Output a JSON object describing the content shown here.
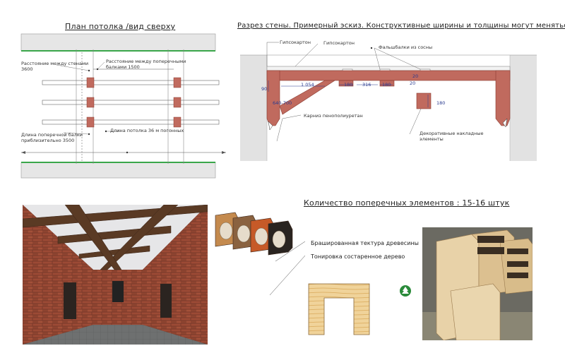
{
  "plan": {
    "title": "План потолка /вид сверху",
    "label_wall_distance": "Расстояние между стенами\n3600",
    "label_beam_distance": "Расстояние между поперечными\nбалками 1500",
    "label_beam_length": "Длина поперечной балки\nприблизительно 3500",
    "label_ceiling_length": "Длина потолка 36 м погонных"
  },
  "section": {
    "title": "Разрез стены. Примерный эскиз. Конструктивные ширины и толщины могут меняться.",
    "label_drywall_1": "Гипсокартон",
    "label_drywall_2": "Гипсокартон",
    "label_joists": "Фальшбалки из сосны",
    "label_cornice": "Карниз пенополиуретан",
    "label_decor": "Декоративные накладные\nэлементы",
    "dim_90": "90",
    "dim_1054": "1 054",
    "dim_180a": "180",
    "dim_316": "316",
    "dim_180b": "180",
    "dim_20a": "20",
    "dim_20b": "20",
    "dim_180c": "180",
    "dim_misc": "640-700"
  },
  "elements": {
    "title": "Количество поперечных элементов : 15-16 штук",
    "label_texture": "Брашированная тектура древесины",
    "label_toning": "Тонировка состаренное дерево"
  },
  "colors": {
    "beam": "#c06a5e",
    "beam_stroke": "#8a3a30",
    "green_line": "#3aa64a",
    "wall_gray": "#e2e2e2"
  }
}
